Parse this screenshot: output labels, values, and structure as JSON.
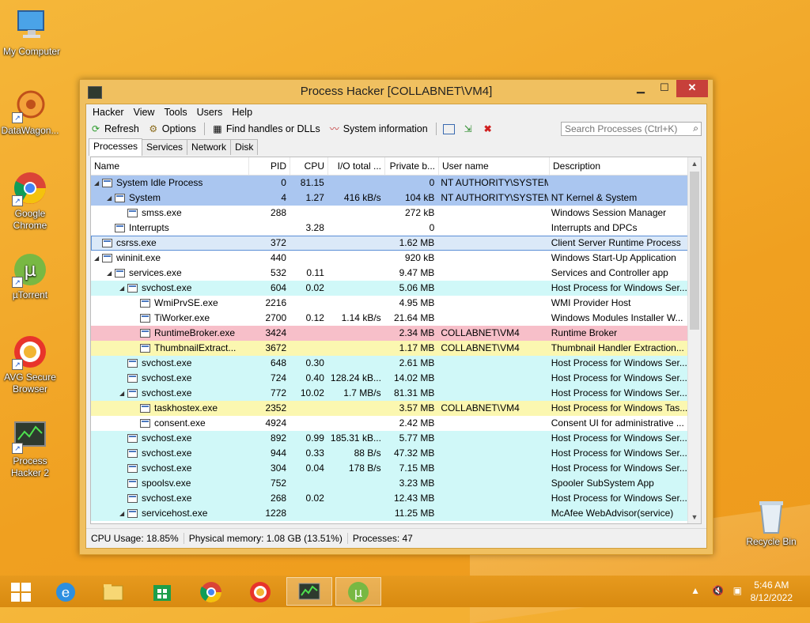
{
  "desktop": {
    "icons": [
      {
        "label": "My Computer"
      },
      {
        "label": "DataWagon..."
      },
      {
        "label": "Google Chrome"
      },
      {
        "label": "µTorrent"
      },
      {
        "label": "AVG Secure Browser"
      },
      {
        "label": "Process Hacker 2"
      },
      {
        "label": "Recycle Bin"
      }
    ]
  },
  "window": {
    "title": "Process Hacker [COLLABNET\\VM4]",
    "min_glyph": "▁",
    "max_glyph": "☐",
    "close_glyph": "✕",
    "menu": [
      "Hacker",
      "View",
      "Tools",
      "Users",
      "Help"
    ],
    "toolbar": {
      "refresh": "Refresh",
      "options": "Options",
      "find_handles": "Find handles or DLLs",
      "system_info": "System information",
      "search_placeholder": "Search Processes (Ctrl+K)"
    },
    "tabs": [
      "Processes",
      "Services",
      "Network",
      "Disk"
    ],
    "columns": [
      "Name",
      "PID",
      "CPU",
      "I/O total ...",
      "Private b...",
      "User name",
      "Description"
    ],
    "rows": [
      {
        "depth": 0,
        "twisty": "◢",
        "name": "System Idle Process",
        "pid": "0",
        "cpu": "81.15",
        "io": "",
        "priv": "0",
        "user": "NT AUTHORITY\\SYSTEM",
        "desc": "",
        "bg": "system"
      },
      {
        "depth": 1,
        "twisty": "◢",
        "name": "System",
        "pid": "4",
        "cpu": "1.27",
        "io": "416 kB/s",
        "priv": "104 kB",
        "user": "NT AUTHORITY\\SYSTEM",
        "desc": "NT Kernel & System",
        "bg": "system"
      },
      {
        "depth": 2,
        "twisty": "",
        "name": "smss.exe",
        "pid": "288",
        "cpu": "",
        "io": "",
        "priv": "272 kB",
        "user": "",
        "desc": "Windows Session Manager",
        "bg": "white"
      },
      {
        "depth": 1,
        "twisty": "",
        "name": "Interrupts",
        "pid": "",
        "cpu": "3.28",
        "io": "",
        "priv": "0",
        "user": "",
        "desc": "Interrupts and DPCs",
        "bg": "white"
      },
      {
        "depth": 0,
        "twisty": "",
        "name": "csrss.exe",
        "pid": "372",
        "cpu": "",
        "io": "",
        "priv": "1.62 MB",
        "user": "",
        "desc": "Client Server Runtime Process",
        "bg": "selected"
      },
      {
        "depth": 0,
        "twisty": "◢",
        "name": "wininit.exe",
        "pid": "440",
        "cpu": "",
        "io": "",
        "priv": "920 kB",
        "user": "",
        "desc": "Windows Start-Up Application",
        "bg": "white"
      },
      {
        "depth": 1,
        "twisty": "◢",
        "name": "services.exe",
        "pid": "532",
        "cpu": "0.11",
        "io": "",
        "priv": "9.47 MB",
        "user": "",
        "desc": "Services and Controller app",
        "bg": "white"
      },
      {
        "depth": 2,
        "twisty": "◢",
        "name": "svchost.exe",
        "pid": "604",
        "cpu": "0.02",
        "io": "",
        "priv": "5.06 MB",
        "user": "",
        "desc": "Host Process for Windows Ser...",
        "bg": "service"
      },
      {
        "depth": 3,
        "twisty": "",
        "name": "WmiPrvSE.exe",
        "pid": "2216",
        "cpu": "",
        "io": "",
        "priv": "4.95 MB",
        "user": "",
        "desc": "WMI Provider Host",
        "bg": "white"
      },
      {
        "depth": 3,
        "twisty": "",
        "name": "TiWorker.exe",
        "pid": "2700",
        "cpu": "0.12",
        "io": "1.14 kB/s",
        "priv": "21.64 MB",
        "user": "",
        "desc": "Windows Modules Installer W...",
        "bg": "white"
      },
      {
        "depth": 3,
        "twisty": "",
        "name": "RuntimeBroker.exe",
        "pid": "3424",
        "cpu": "",
        "io": "",
        "priv": "2.34 MB",
        "user": "COLLABNET\\VM4",
        "desc": "Runtime Broker",
        "bg": "pink"
      },
      {
        "depth": 3,
        "twisty": "",
        "name": "ThumbnailExtract...",
        "pid": "3672",
        "cpu": "",
        "io": "",
        "priv": "1.17 MB",
        "user": "COLLABNET\\VM4",
        "desc": "Thumbnail Handler Extraction...",
        "bg": "yellow"
      },
      {
        "depth": 2,
        "twisty": "",
        "name": "svchost.exe",
        "pid": "648",
        "cpu": "0.30",
        "io": "",
        "priv": "2.61 MB",
        "user": "",
        "desc": "Host Process for Windows Ser...",
        "bg": "service"
      },
      {
        "depth": 2,
        "twisty": "",
        "name": "svchost.exe",
        "pid": "724",
        "cpu": "0.40",
        "io": "128.24 kB...",
        "priv": "14.02 MB",
        "user": "",
        "desc": "Host Process for Windows Ser...",
        "bg": "service"
      },
      {
        "depth": 2,
        "twisty": "◢",
        "name": "svchost.exe",
        "pid": "772",
        "cpu": "10.02",
        "io": "1.7 MB/s",
        "priv": "81.31 MB",
        "user": "",
        "desc": "Host Process for Windows Ser...",
        "bg": "service"
      },
      {
        "depth": 3,
        "twisty": "",
        "name": "taskhostex.exe",
        "pid": "2352",
        "cpu": "",
        "io": "",
        "priv": "3.57 MB",
        "user": "COLLABNET\\VM4",
        "desc": "Host Process for Windows Tas...",
        "bg": "yellow"
      },
      {
        "depth": 3,
        "twisty": "",
        "name": "consent.exe",
        "pid": "4924",
        "cpu": "",
        "io": "",
        "priv": "2.42 MB",
        "user": "",
        "desc": "Consent UI for administrative ...",
        "bg": "white"
      },
      {
        "depth": 2,
        "twisty": "",
        "name": "svchost.exe",
        "pid": "892",
        "cpu": "0.99",
        "io": "185.31 kB...",
        "priv": "5.77 MB",
        "user": "",
        "desc": "Host Process for Windows Ser...",
        "bg": "service"
      },
      {
        "depth": 2,
        "twisty": "",
        "name": "svchost.exe",
        "pid": "944",
        "cpu": "0.33",
        "io": "88 B/s",
        "priv": "47.32 MB",
        "user": "",
        "desc": "Host Process for Windows Ser...",
        "bg": "service"
      },
      {
        "depth": 2,
        "twisty": "",
        "name": "svchost.exe",
        "pid": "304",
        "cpu": "0.04",
        "io": "178 B/s",
        "priv": "7.15 MB",
        "user": "",
        "desc": "Host Process for Windows Ser...",
        "bg": "service"
      },
      {
        "depth": 2,
        "twisty": "",
        "name": "spoolsv.exe",
        "pid": "752",
        "cpu": "",
        "io": "",
        "priv": "3.23 MB",
        "user": "",
        "desc": "Spooler SubSystem App",
        "bg": "service"
      },
      {
        "depth": 2,
        "twisty": "",
        "name": "svchost.exe",
        "pid": "268",
        "cpu": "0.02",
        "io": "",
        "priv": "12.43 MB",
        "user": "",
        "desc": "Host Process for Windows Ser...",
        "bg": "service"
      },
      {
        "depth": 2,
        "twisty": "◢",
        "name": "servicehost.exe",
        "pid": "1228",
        "cpu": "",
        "io": "",
        "priv": "11.25 MB",
        "user": "",
        "desc": "McAfee WebAdvisor(service)",
        "bg": "service"
      }
    ],
    "status": {
      "cpu": "CPU Usage: 18.85%",
      "memory": "Physical memory: 1.08 GB (13.51%)",
      "processes": "Processes: 47"
    }
  },
  "taskbar": {
    "time": "5:46 AM",
    "date": "8/12/2022"
  },
  "colors": {
    "system": "#aac6f0",
    "service": "#d0f8f8",
    "pink": "#f7bfc9",
    "yellow": "#fbf7b0"
  }
}
